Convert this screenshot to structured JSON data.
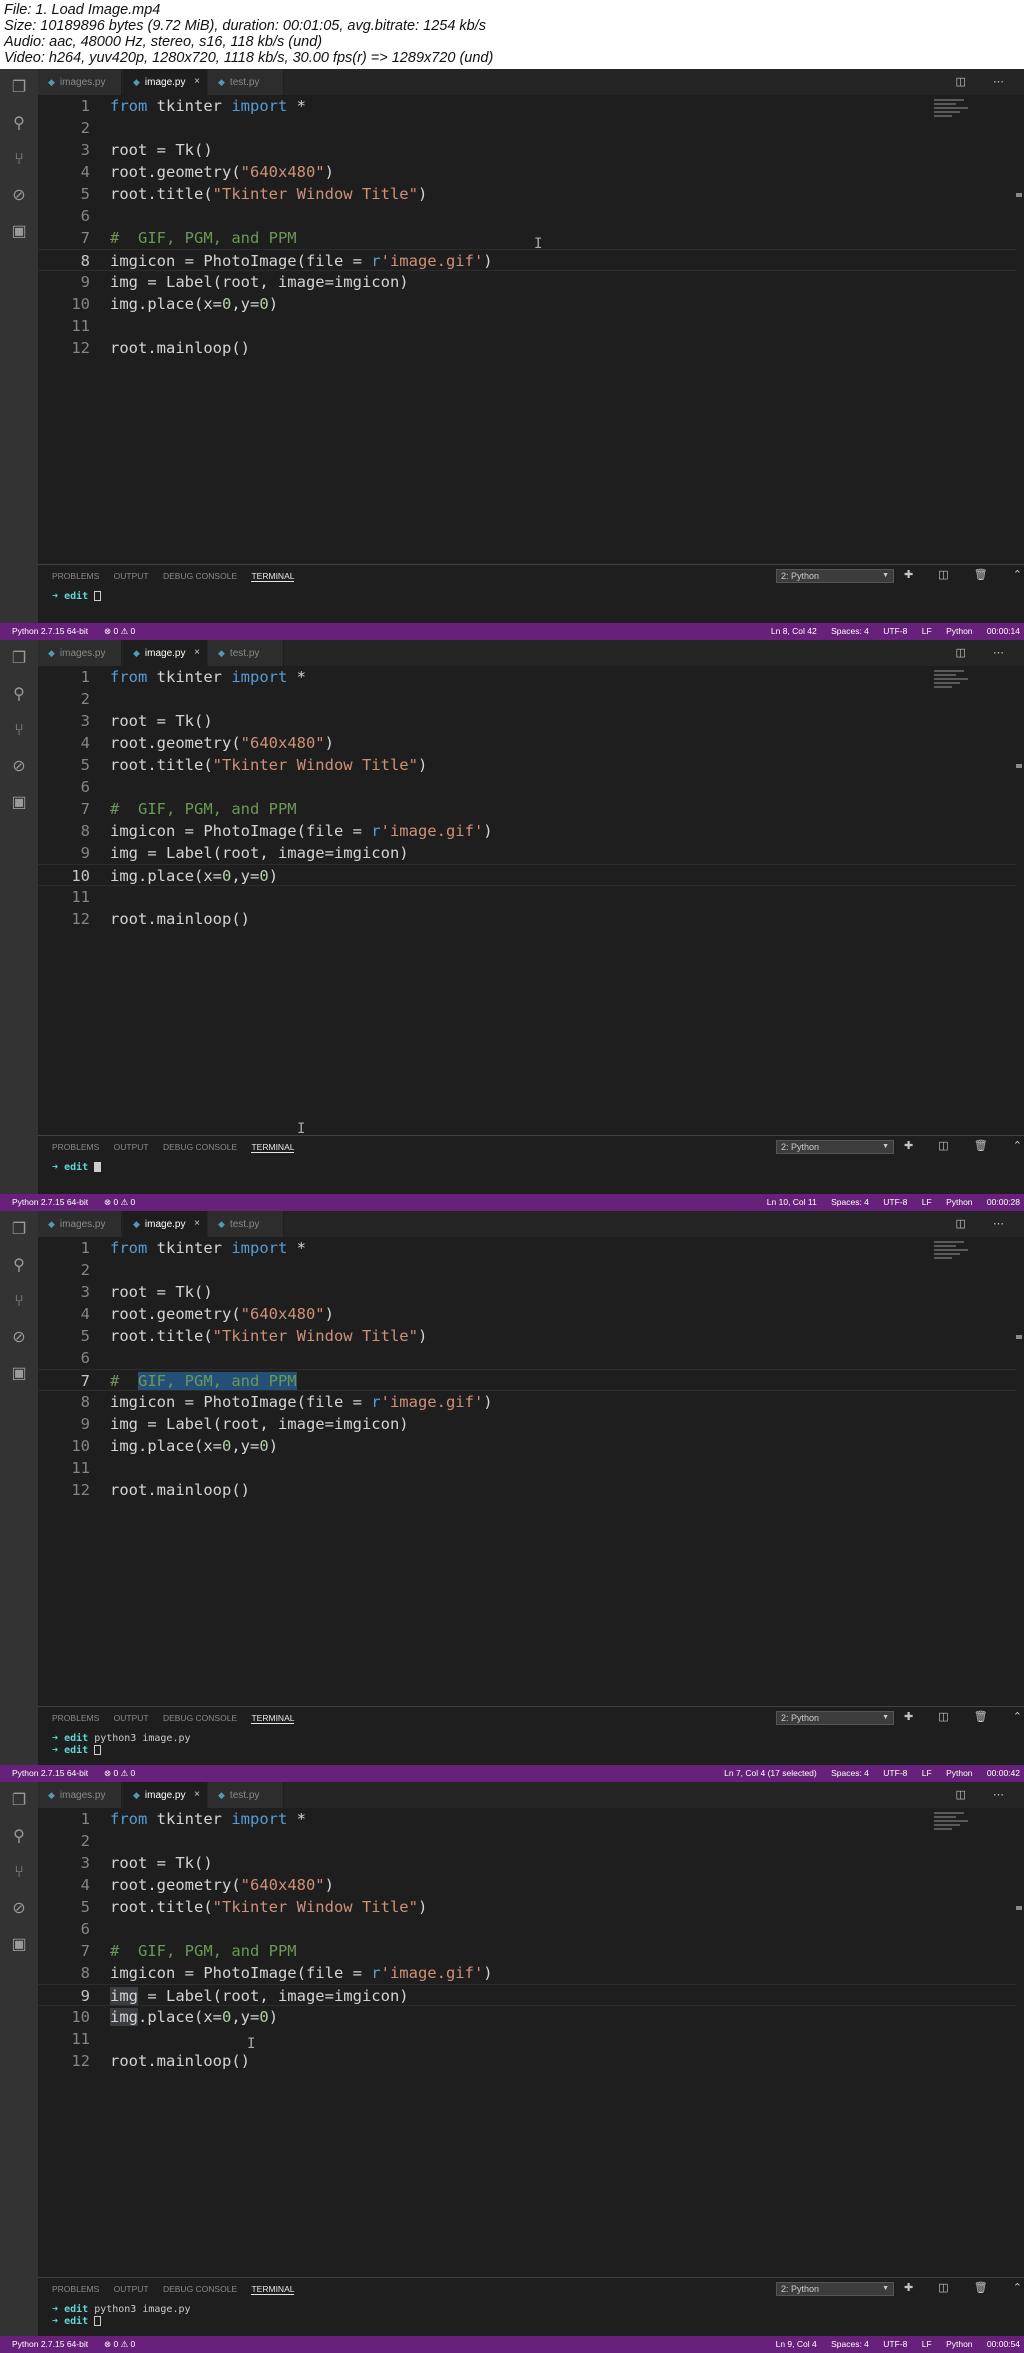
{
  "header": {
    "line1": "File: 1. Load Image.mp4",
    "line2": "Size: 10189896 bytes (9.72 MiB), duration: 00:01:05, avg.bitrate: 1254 kb/s",
    "line3": "Audio: aac, 48000 Hz, stereo, s16, 118 kb/s (und)",
    "line4": "Video: h264, yuv420p, 1280x720, 1118 kb/s, 30.00 fps(r) => 1289x720 (und)"
  },
  "tabs": {
    "tab1": "images.py",
    "tab2": "image.py",
    "tab3": "test.py",
    "close": "×",
    "icons": "◫ ⋯"
  },
  "code": {
    "l1a": "from",
    "l1b": " tkinter ",
    "l1c": "import",
    "l1d": " *",
    "l3": "root = Tk()",
    "l4a": "root.geometry(",
    "l4b": "\"640x480\"",
    "l4c": ")",
    "l5a": "root.title(",
    "l5b": "\"Tkinter Window Title\"",
    "l5c": ")",
    "l7a": "#  ",
    "l7b": "GIF, PGM, and PPM",
    "l8a": "imgicon = PhotoImage(file = ",
    "l8b": "r",
    "l8c": "'image.gif'",
    "l8d": ")",
    "l9a": "img",
    "l9b": " = Label(root, image=imgicon)",
    "l10a": "img",
    "l10b": ".place(x=",
    "l10c": "0",
    "l10d": ",y=",
    "l10e": "0",
    "l10f": ")",
    "l12": "root.mainloop()"
  },
  "panel": {
    "problems": "PROBLEMS",
    "output": "OUTPUT",
    "debug": "DEBUG CONSOLE",
    "terminal": "TERMINAL",
    "select": "2: Python",
    "icons": "✚ ◫ 🗑 ⌃ ✕"
  },
  "terminal": {
    "arrow": "➜",
    "dir": "edit",
    "cmd": "python3 image.py"
  },
  "status": {
    "python": "Python 2.7.15 64-bit",
    "errors": "⊗ 0  ⚠ 0",
    "spaces": "Spaces: 4",
    "enc": "UTF-8",
    "eol": "LF",
    "lang": "Python",
    "f1_pos": "Ln 8, Col 42",
    "f2_pos": "Ln 10, Col 11",
    "f3_pos": "Ln 7, Col 4 (17 selected)",
    "f4_pos": "Ln 9, Col 4",
    "f1_time": "00:00:14",
    "f2_time": "00:00:28",
    "f3_time": "00:00:42",
    "f4_time": "00:00:54"
  },
  "icons": [
    "files-icon",
    "search-icon",
    "source-control-icon",
    "debug-icon",
    "extensions-icon",
    "gear-icon"
  ]
}
